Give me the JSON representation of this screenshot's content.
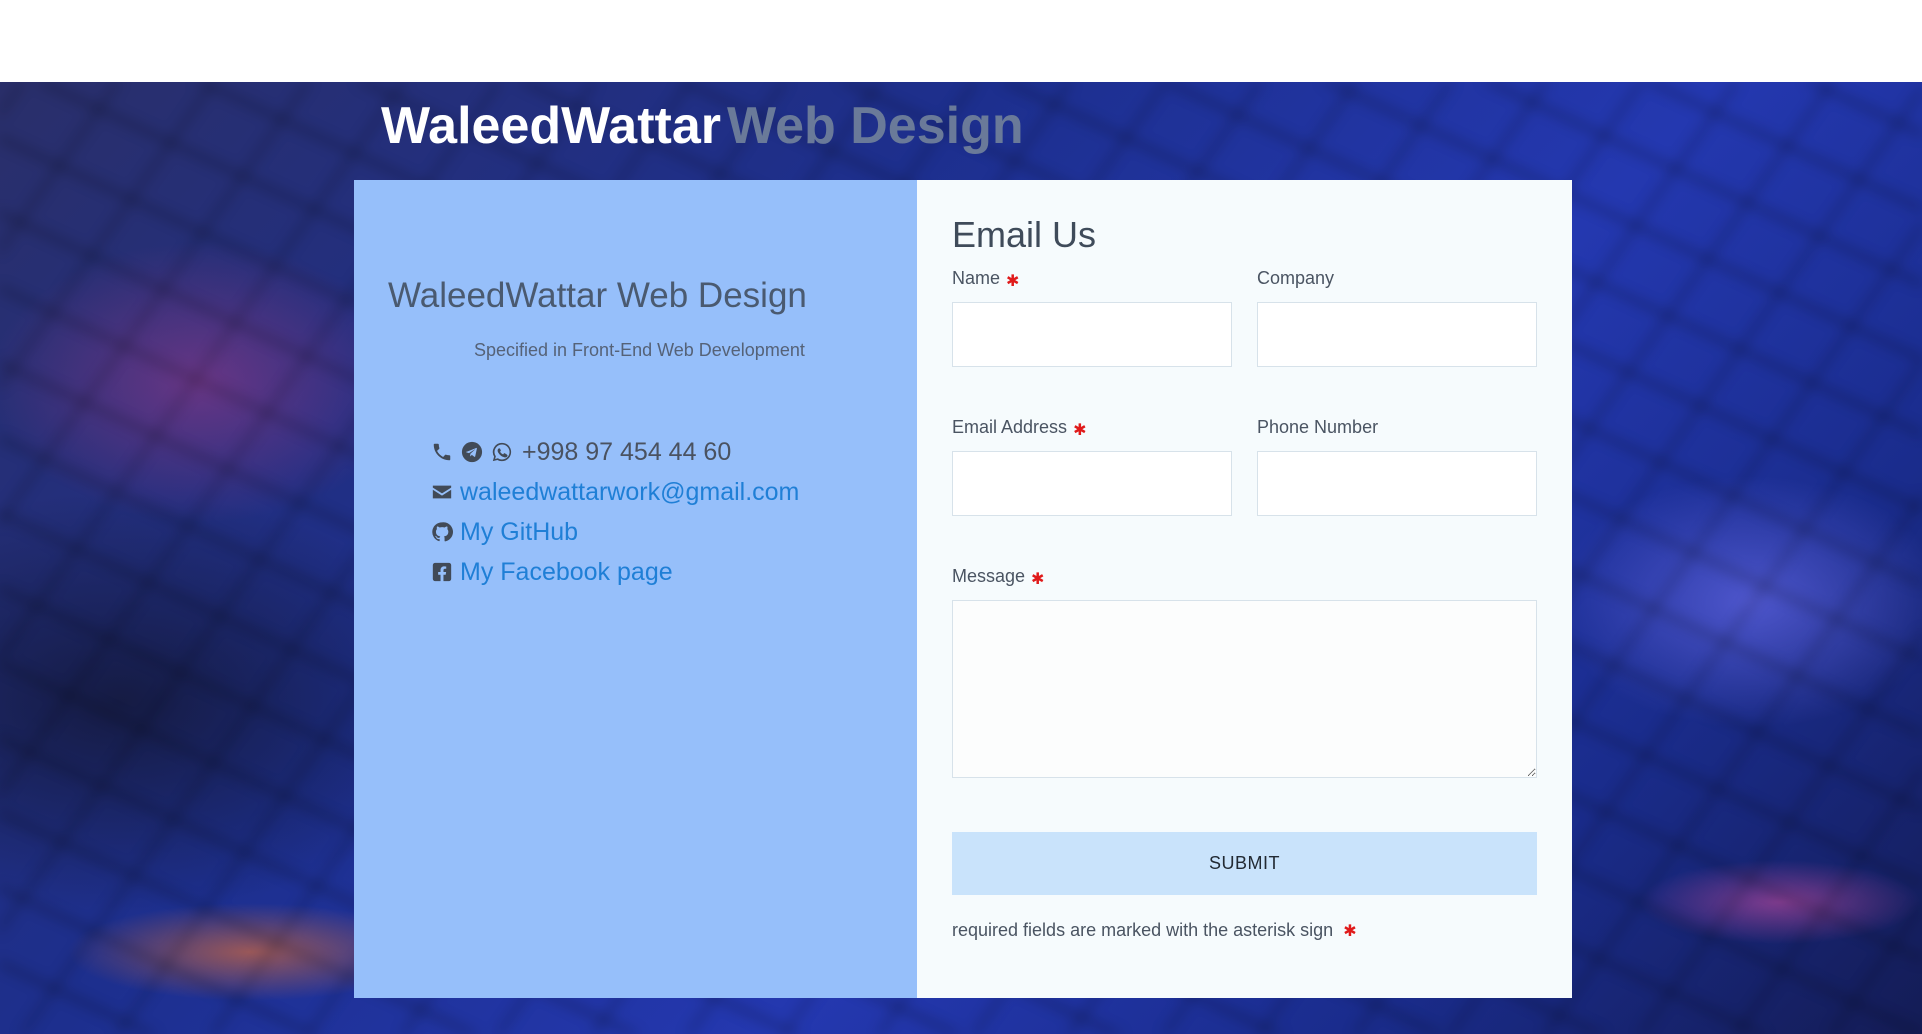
{
  "brand": {
    "main": "WaleedWattar",
    "sub": "Web Design"
  },
  "info": {
    "title": "WaleedWattar Web Design",
    "tagline": "Specified in Front-End Web Development",
    "contacts": {
      "phone": "+998 97 454 44 60",
      "email": "waleedwattarwork@gmail.com",
      "github": "My GitHub",
      "facebook": "My Facebook page"
    }
  },
  "form": {
    "heading": "Email Us",
    "fields": {
      "name": {
        "label": "Name",
        "required": "✱"
      },
      "company": {
        "label": "Company"
      },
      "email": {
        "label": "Email Address",
        "required": "✱"
      },
      "phone": {
        "label": "Phone Number"
      },
      "message": {
        "label": "Message",
        "required": "✱"
      }
    },
    "submit_label": "SUBMIT",
    "note": "required fields are marked with the asterisk sign",
    "note_mark": "✱"
  },
  "icons": [
    "phone-icon",
    "telegram-icon",
    "whatsapp-icon",
    "envelope-icon",
    "github-icon",
    "facebook-square-icon"
  ],
  "colors": {
    "info_panel": "#96bffa",
    "form_panel": "#f6fbfd",
    "link": "#1f7fd6",
    "submit_bg": "#c9e3fb",
    "required": "#e01a1a",
    "brand_sub": "#6a7a99"
  }
}
